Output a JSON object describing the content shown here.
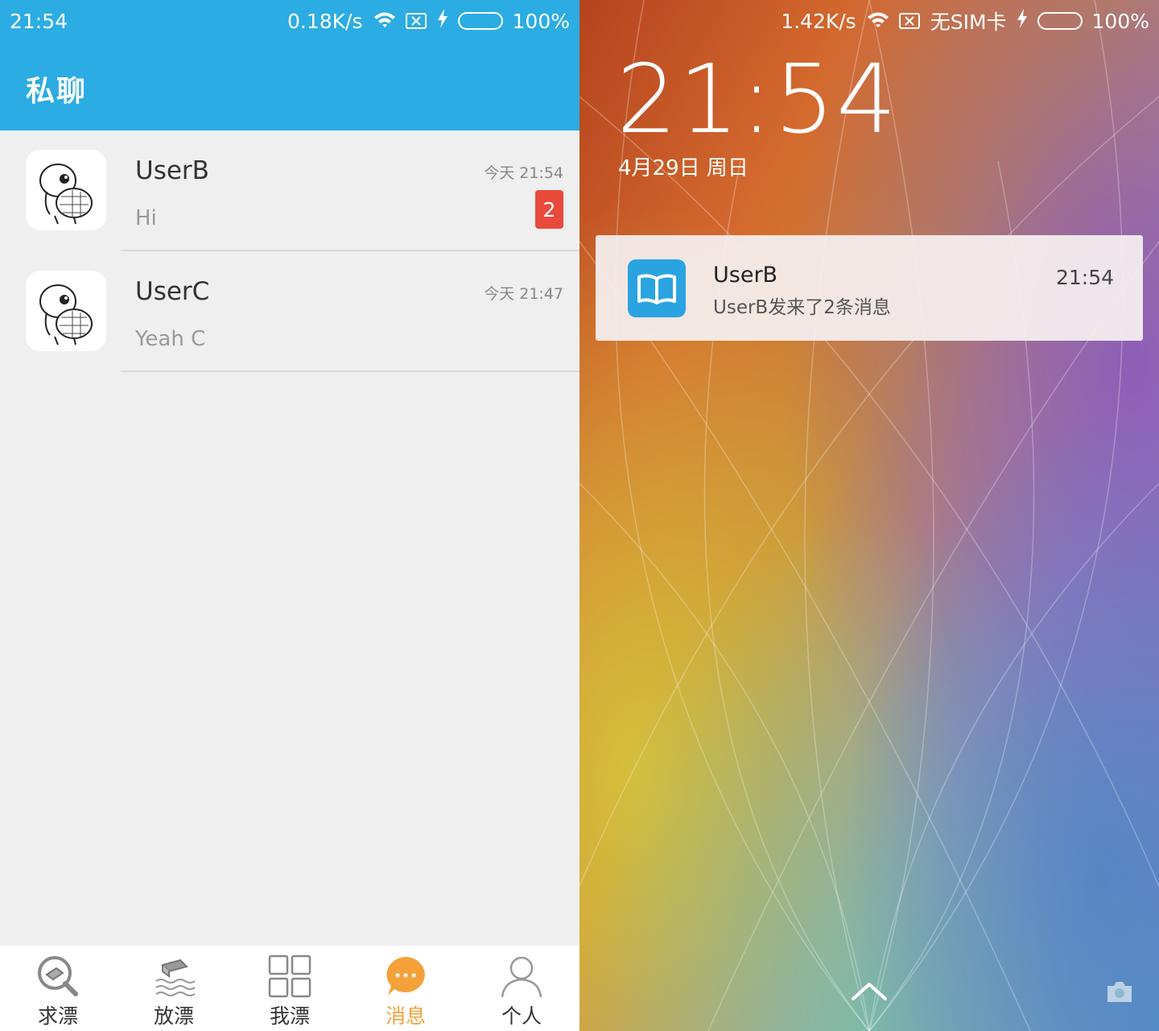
{
  "left": {
    "status": {
      "time": "21:54",
      "speed": "0.18K/s",
      "battery_percent": "100%",
      "battery_level": 1.0,
      "icons": [
        "wifi-icon",
        "no-sim-icon",
        "charging-icon",
        "battery-icon"
      ]
    },
    "appbar": {
      "title": "私聊"
    },
    "chats": [
      {
        "name": "UserB",
        "preview": "Hi",
        "stamp": "今天 21:54",
        "unread": "2"
      },
      {
        "name": "UserC",
        "preview": "Yeah C",
        "stamp": "今天 21:47",
        "unread": ""
      }
    ],
    "tabs": [
      {
        "label": "求漂",
        "icon": "search-book-icon",
        "active": false
      },
      {
        "label": "放漂",
        "icon": "float-book-icon",
        "active": false
      },
      {
        "label": "我漂",
        "icon": "grid-icon",
        "active": false
      },
      {
        "label": "消息",
        "icon": "chat-bubble-icon",
        "active": true
      },
      {
        "label": "个人",
        "icon": "person-icon",
        "active": false
      }
    ],
    "colors": {
      "appbar": "#2bace2",
      "badge": "#e94a3c",
      "active_tab": "#f4a13a",
      "battery_fill": "#3cc83c"
    }
  },
  "right": {
    "status": {
      "speed": "1.42K/s",
      "sim": "无SIM卡",
      "battery_percent": "100%",
      "battery_level": 1.0
    },
    "clock": "21:54",
    "date": "4月29日 周日",
    "notification": {
      "title": "UserB",
      "text": "UserB发来了2条消息",
      "time": "21:54",
      "icon": "book-icon"
    },
    "bottom": {
      "unlock_icon": "chevron-up-icon",
      "camera_icon": "camera-icon"
    }
  }
}
